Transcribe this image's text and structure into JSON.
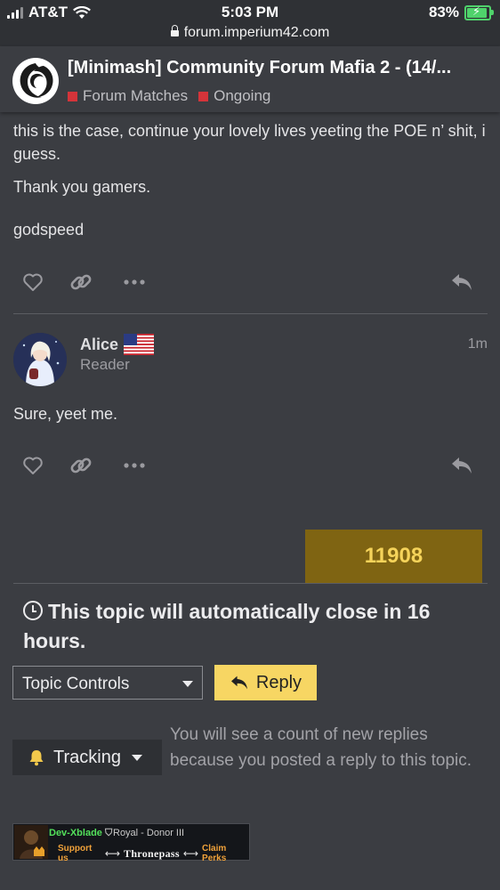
{
  "status_bar": {
    "carrier": "AT&T",
    "time": "5:03 PM",
    "battery": "83%",
    "battery_level": 0.83
  },
  "browser": {
    "url": "forum.imperium42.com"
  },
  "topic_header": {
    "title": "[Minimash] Community Forum Mafia 2 - (14/...",
    "categories": [
      {
        "label": "Forum Matches",
        "color": "#d4343a"
      },
      {
        "label": "Ongoing",
        "color": "#d4343a"
      }
    ]
  },
  "posts": [
    {
      "paragraphs": [
        "this is the case, continue your lovely lives yeeting the POE n’ shit, i guess.",
        "Thank you gamers.",
        "godspeed"
      ]
    },
    {
      "author": "Alice",
      "role": "Reader",
      "time": "1m",
      "body": "Sure, yeet me."
    }
  ],
  "post_counter": "11908",
  "close_notice": "This topic will automatically close in 16 hours.",
  "controls": {
    "topic_controls_label": "Topic Controls",
    "reply_label": "Reply",
    "tracking_label": "Tracking",
    "tracking_note": "You will see a count of new replies because you posted a reply to this topic."
  },
  "signature": {
    "name": "Dev-Xblade",
    "rank": "Royal - Donor III",
    "support": "Support us",
    "brand": "Thronepass",
    "claim": "Claim Perks"
  },
  "colors": {
    "background": "#3b3d42",
    "reply_button": "#f7d663",
    "counter_bg": "#7f6412",
    "category": "#d4343a"
  }
}
